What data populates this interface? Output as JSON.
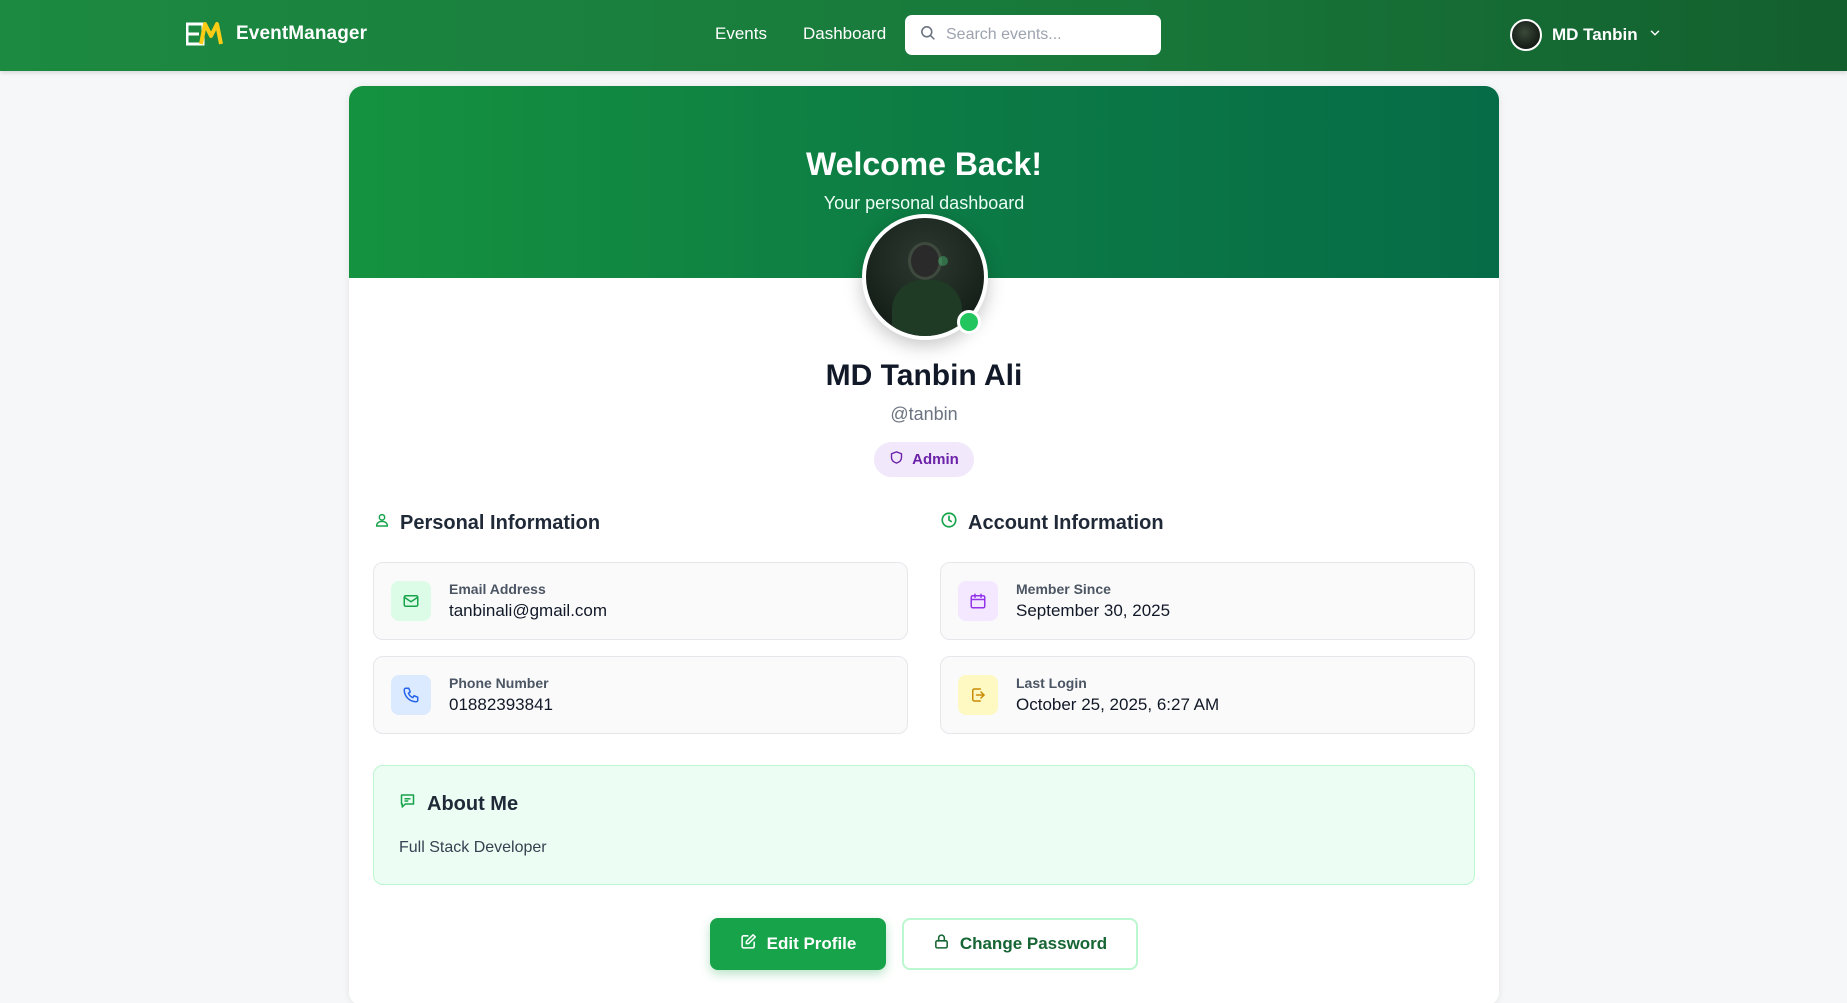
{
  "navbar": {
    "brand_name": "EventManager",
    "links": [
      "Events",
      "Dashboard"
    ],
    "search_placeholder": "Search events...",
    "user_name": "MD Tanbin"
  },
  "hero": {
    "title": "Welcome Back!",
    "subtitle": "Your personal dashboard"
  },
  "profile": {
    "name": "MD Tanbin Ali",
    "handle": "@tanbin",
    "role": "Admin",
    "online": true
  },
  "personal_info": {
    "title": "Personal Information",
    "items": [
      {
        "label": "Email Address",
        "value": "tanbinali@gmail.com",
        "icon": "mail-icon"
      },
      {
        "label": "Phone Number",
        "value": "01882393841",
        "icon": "phone-icon"
      }
    ]
  },
  "account_info": {
    "title": "Account Information",
    "items": [
      {
        "label": "Member Since",
        "value": "September 30, 2025",
        "icon": "calendar-icon"
      },
      {
        "label": "Last Login",
        "value": "October 25, 2025, 6:27 AM",
        "icon": "login-icon"
      }
    ]
  },
  "about": {
    "title": "About Me",
    "text": "Full Stack Developer"
  },
  "actions": {
    "edit_label": "Edit Profile",
    "password_label": "Change Password"
  },
  "colors": {
    "primary": "#16a34a",
    "header": "#1c8a41",
    "admin_badge": "#f1e8fb",
    "about_bg": "#ecfdf3"
  }
}
